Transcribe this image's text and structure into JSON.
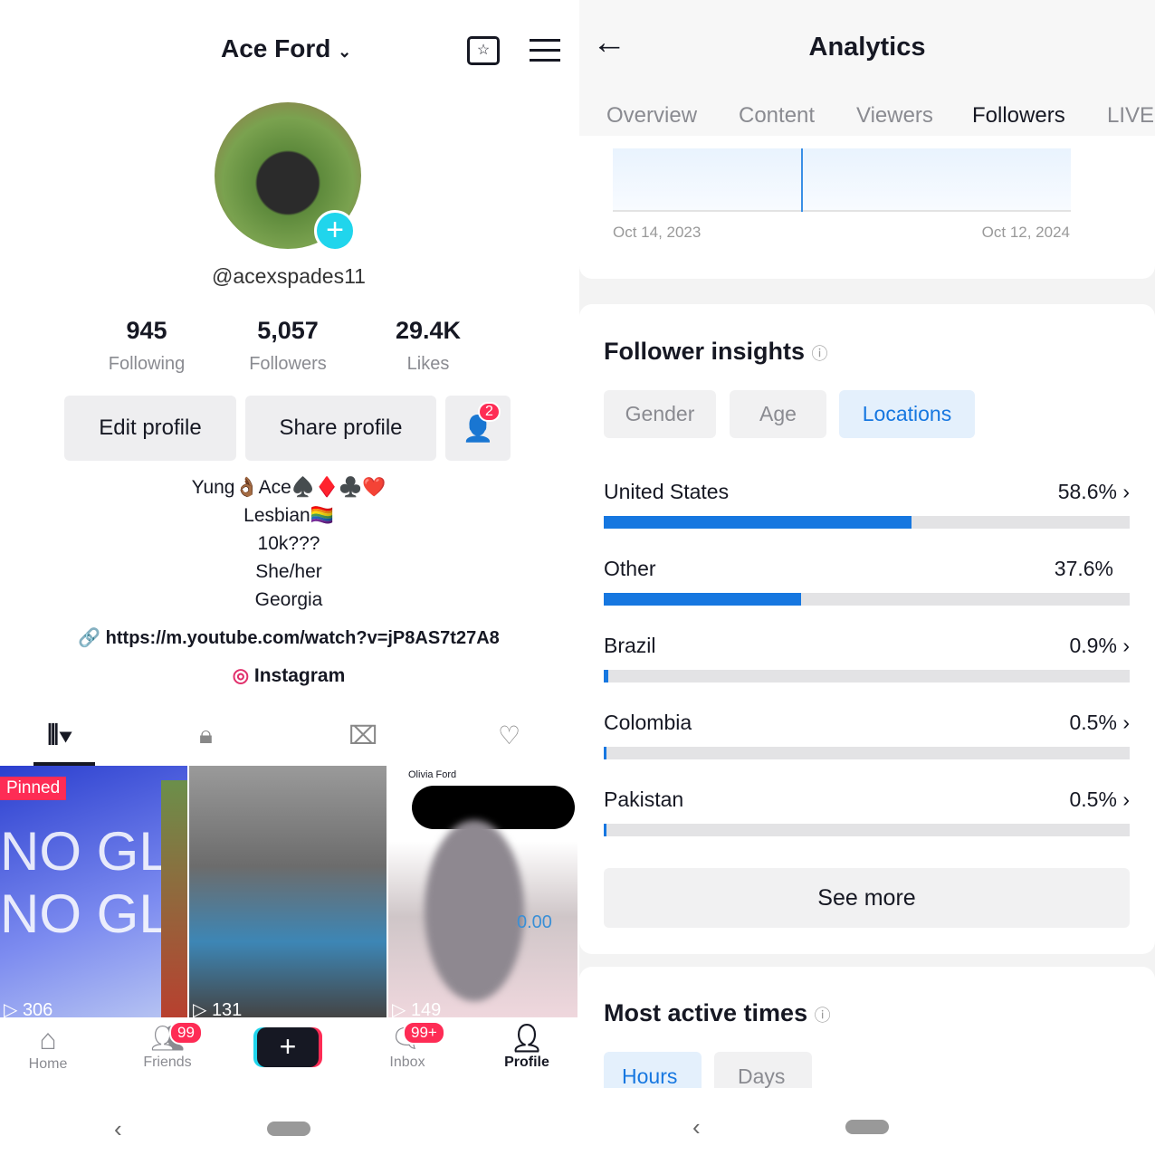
{
  "profile": {
    "username_title": "Ace Ford",
    "handle": "@acexspades11",
    "stats": [
      {
        "value": "945",
        "label": "Following"
      },
      {
        "value": "5,057",
        "label": "Followers"
      },
      {
        "value": "29.4K",
        "label": "Likes"
      }
    ],
    "edit_label": "Edit profile",
    "share_label": "Share profile",
    "friend_badge": "2",
    "bio": [
      "Yung👌🏾Ace♠️♦️♣️❤️",
      "Lesbian🏳️‍🌈",
      "10k???",
      "She/her",
      "Georgia"
    ],
    "link": "https://m.youtube.com/watch?v=jP8AS7t27A8",
    "instagram": "Instagram",
    "videos": [
      {
        "views": "306",
        "pinned": "Pinned"
      },
      {
        "views": "131"
      },
      {
        "views": "149",
        "tag": "Olivia Ford",
        "amount": "0.00"
      }
    ],
    "nav": [
      {
        "label": "Home"
      },
      {
        "label": "Friends",
        "badge": "99"
      },
      {
        "label": ""
      },
      {
        "label": "Inbox",
        "badge": "99+"
      },
      {
        "label": "Profile"
      }
    ]
  },
  "analytics": {
    "title": "Analytics",
    "tabs": [
      "Overview",
      "Content",
      "Viewers",
      "Followers",
      "LIVE"
    ],
    "active_tab": "Followers",
    "chart": {
      "start": "Oct 14, 2023",
      "end": "Oct 12, 2024"
    },
    "insights_title": "Follower insights",
    "chips": [
      "Gender",
      "Age",
      "Locations"
    ],
    "locations": [
      {
        "name": "United States",
        "pct": "58.6%",
        "value": 58.6,
        "chevron": true
      },
      {
        "name": "Other",
        "pct": "37.6%",
        "value": 37.6,
        "chevron": false
      },
      {
        "name": "Brazil",
        "pct": "0.9%",
        "value": 0.9,
        "chevron": true
      },
      {
        "name": "Colombia",
        "pct": "0.5%",
        "value": 0.5,
        "chevron": true
      },
      {
        "name": "Pakistan",
        "pct": "0.5%",
        "value": 0.5,
        "chevron": true
      }
    ],
    "see_more": "See more",
    "active_title": "Most active times",
    "time_chips": [
      "Hours",
      "Days"
    ]
  },
  "colors": {
    "accent": "#1677e0",
    "badge": "#fe2c55",
    "add": "#20d5ec"
  }
}
